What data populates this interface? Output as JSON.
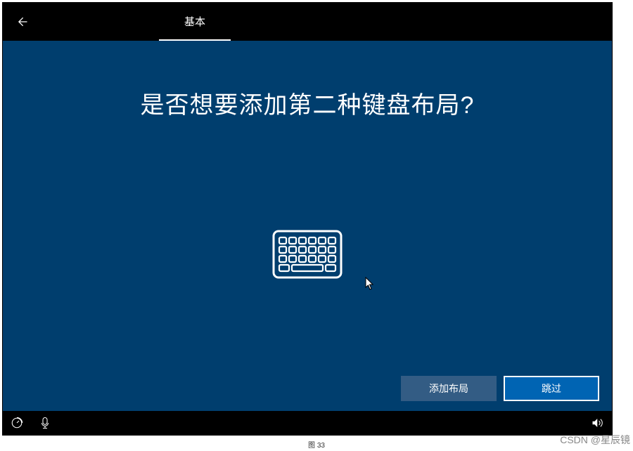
{
  "topbar": {
    "tabs": [
      {
        "label": "基本",
        "active": true
      }
    ]
  },
  "content": {
    "heading": "是否想要添加第二种键盘布局?"
  },
  "buttons": {
    "add_layout": "添加布局",
    "skip": "跳过"
  },
  "watermark": "CSDN @星辰镜",
  "caption": "图 33"
}
